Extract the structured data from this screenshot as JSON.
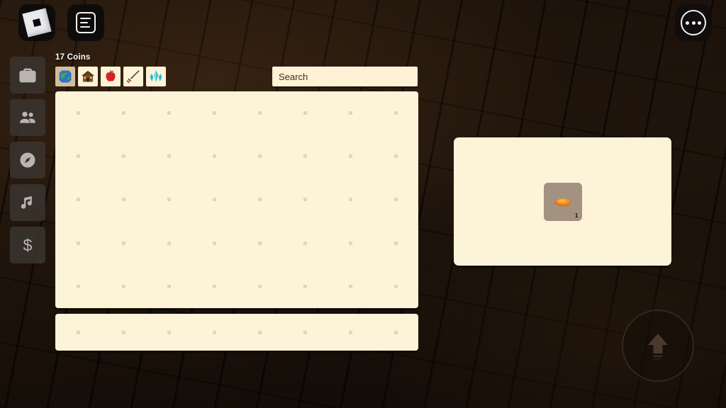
{
  "window": {
    "game_background": "#241509"
  },
  "topbar": {
    "roblox_button": {
      "icon": "roblox-logo-icon",
      "label": "Roblox"
    },
    "chat_button": {
      "icon": "chat-icon",
      "label": "Chat"
    },
    "more_button": {
      "icon": "more-dots-icon",
      "label": "More"
    }
  },
  "sidebar": {
    "items": [
      {
        "icon": "briefcase-icon",
        "label": "Inventory"
      },
      {
        "icon": "people-icon",
        "label": "Friends"
      },
      {
        "icon": "compass-icon",
        "label": "Explore"
      },
      {
        "icon": "music-note-icon",
        "label": "Music"
      },
      {
        "icon": "dollar-sign-icon",
        "label": "Shop"
      }
    ]
  },
  "inventory": {
    "coins_label": "17 Coins",
    "coins_value": 17,
    "categories": [
      {
        "icon": "globe-icon",
        "label": "World",
        "selected": true
      },
      {
        "icon": "house-icon",
        "label": "Build",
        "selected": false
      },
      {
        "icon": "apple-icon",
        "label": "Food",
        "selected": false
      },
      {
        "icon": "sword-icon",
        "label": "Weapons",
        "selected": false
      },
      {
        "icon": "crystal-icon",
        "label": "Gems",
        "selected": false
      }
    ],
    "search": {
      "value": "",
      "placeholder": "Search"
    },
    "grid": {
      "columns": 8,
      "rows": 5,
      "empty_slots": 40
    },
    "hotbar": {
      "columns": 8,
      "rows": 1,
      "empty_slots": 8
    }
  },
  "detail_panel": {
    "item": {
      "icon": "bread-item-icon",
      "count": "1",
      "color": "#f08a1e"
    }
  },
  "controls": {
    "jump_button": {
      "icon": "jump-arrow-icon",
      "label": "Jump"
    }
  },
  "colors": {
    "panel": "#fdf3d8",
    "panel_dot": "#e4d6b3",
    "slot_bg": "#a39281",
    "tab_selected": "#d0c09a",
    "tab_bg": "#fdf3d7",
    "text_light": "#ffffff"
  }
}
